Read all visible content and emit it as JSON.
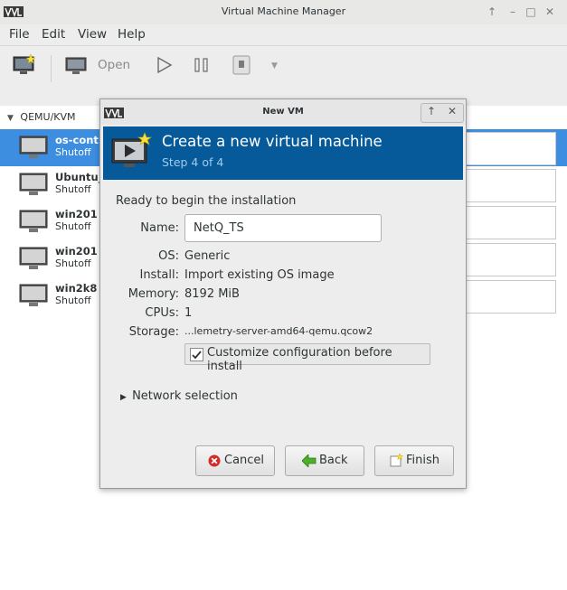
{
  "window": {
    "title": "Virtual Machine Manager"
  },
  "menu": [
    "File",
    "Edit",
    "View",
    "Help"
  ],
  "toolbar": {
    "open_label": "Open"
  },
  "connection": {
    "label": "QEMU/KVM"
  },
  "vms": [
    {
      "name": "os-cont",
      "status": "Shutoff"
    },
    {
      "name": "Ubuntu_",
      "status": "Shutoff"
    },
    {
      "name": "win201",
      "status": "Shutoff"
    },
    {
      "name": "win201",
      "status": "Shutoff"
    },
    {
      "name": "win2k8",
      "status": "Shutoff"
    }
  ],
  "dialog": {
    "title": "New VM",
    "header": "Create a new virtual machine",
    "step": "Step 4 of 4",
    "ready": "Ready to begin the installation",
    "name_label": "Name:",
    "name_value": "NetQ_TS",
    "os_label": "OS:",
    "os_value": "Generic",
    "install_label": "Install:",
    "install_value": "Import existing OS image",
    "memory_label": "Memory:",
    "memory_value": "8192 MiB",
    "cpus_label": "CPUs:",
    "cpus_value": "1",
    "storage_label": "Storage:",
    "storage_value": "...lemetry-server-amd64-qemu.qcow2",
    "customize_label": "Customize configuration before install",
    "customize_checked": true,
    "network_label": "Network selection",
    "cancel_label": "Cancel",
    "back_label": "Back",
    "finish_label": "Finish"
  }
}
